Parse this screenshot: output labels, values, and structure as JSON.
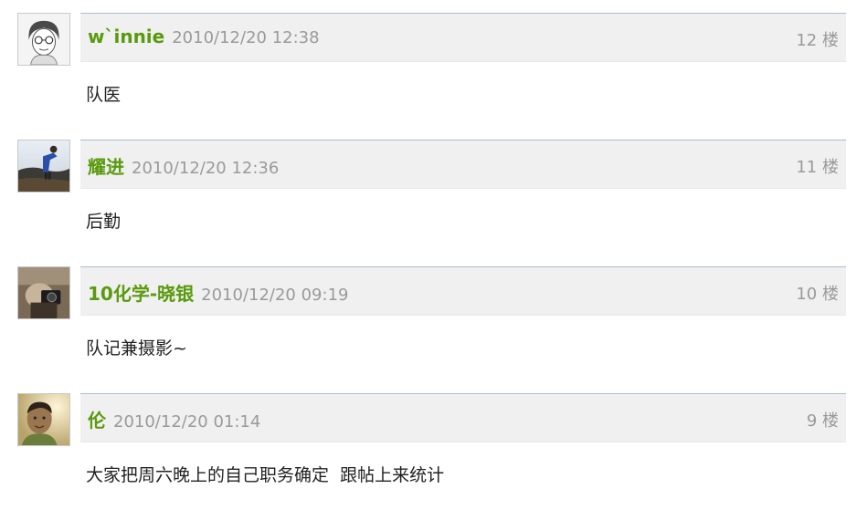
{
  "posts": [
    {
      "author": "w`innie",
      "time": "2010/12/20 12:38",
      "floor": "12 楼",
      "content": "队医",
      "avatar": "sketch-portrait-avatar"
    },
    {
      "author": "耀进",
      "time": "2010/12/20 12:36",
      "floor": "11 楼",
      "content": "后勤",
      "avatar": "outdoor-photo-avatar"
    },
    {
      "author": "10化学-晓银",
      "time": "2010/12/20 09:19",
      "floor": "10 楼",
      "content": "队记兼摄影~",
      "avatar": "camera-photo-avatar"
    },
    {
      "author": "伦",
      "time": "2010/12/20 01:14",
      "floor": "9 楼",
      "content": "大家把周六晚上的自己职务确定  跟帖上来统计",
      "avatar": "portrait-photo-avatar"
    }
  ],
  "colors": {
    "author": "#5a9a0d",
    "meta": "#9a9a9a",
    "header_bg": "#f0f0f0",
    "header_border": "#a9bed0"
  }
}
